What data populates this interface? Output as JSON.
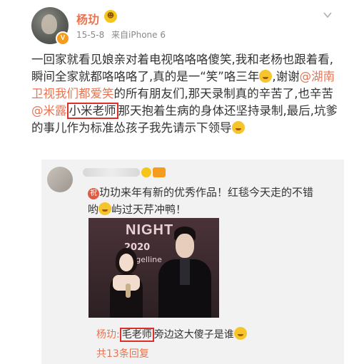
{
  "post": {
    "username": "杨玏",
    "date": "15-5-8",
    "source": "来自iPhone 6",
    "text_1": "一回家就看见娘亲对着电视咯咯咯傻笑,我和老杨也跟着看,瞬间全家就都咯咯咯了,真的是一“笑”咯三年",
    "text_2": ",谢谢",
    "mention_1": "@湖南卫视我们都爱笑",
    "text_3": "的所有朋友们,那天录制真的辛苦了,也辛苦",
    "mention_2": "@米露",
    "boxed_1": "小米老师",
    "text_4": "那天抱着生病的身体还坚持录制,最后,坑爹的事儿作为标准怂孩子我先请示下领导"
  },
  "repost": {
    "zhu_label": "祝",
    "text": "玏玏来年有新的优秀作品！红毯今天走的不错哟",
    "text_tail": "屿过天芹冲鸭！",
    "photo_logo_a": "NIGHT",
    "photo_logo_b": "2020",
    "photo_logo_c": "Magelline",
    "reply_name": "杨玏:",
    "reply_boxed": "毛老师",
    "reply_text": "旁边这大傻子是谁",
    "reply_count": "共13条回复"
  },
  "icons": {
    "avatar": "avatar",
    "verified": "verified-badge-icon",
    "vip": "vip-icon",
    "menu": "chevron-down-icon",
    "emoji": "emoji-icon"
  },
  "colors": {
    "link": "#eb7350",
    "box": "#d9302b",
    "card_bg": "#f2f2f2"
  }
}
